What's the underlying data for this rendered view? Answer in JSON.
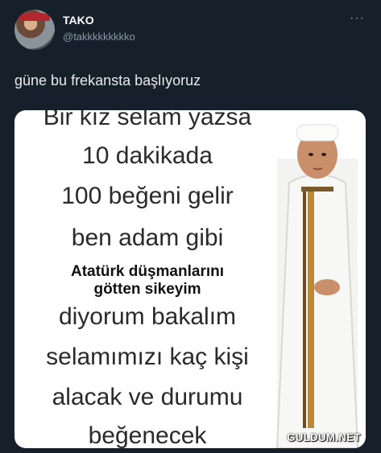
{
  "tweet": {
    "display_name": "TAKO",
    "handle": "@takkkkkkkkko",
    "more_icon": "more-options-icon",
    "text": "güne bu frekansta başlıyoruz"
  },
  "media": {
    "lines_top": [
      "Bir kız selam yazsa",
      "10 dakikada",
      "100 beğeni gelir",
      "ben adam gibi"
    ],
    "bold_lines": [
      "Atatürk düşmanlarını",
      "götten sikeyim"
    ],
    "lines_bottom": [
      "diyorum bakalım",
      "selamımızı kaç kişi",
      "alacak ve durumu",
      "beğenecek"
    ],
    "watermark": "GULDUM.NET"
  },
  "colors": {
    "background": "#15202b",
    "text_primary": "#e7e9ea",
    "text_secondary": "#8b98a5"
  }
}
